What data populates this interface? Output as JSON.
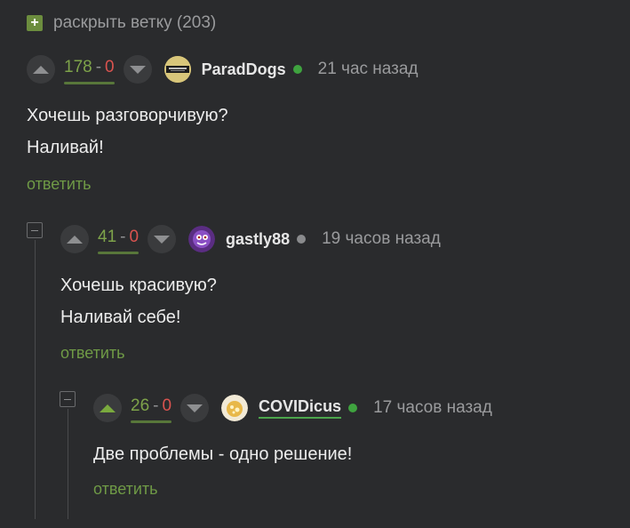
{
  "expand_thread": {
    "label": "раскрыть ветку (203)"
  },
  "comments": [
    {
      "rating_plus": "178",
      "rating_sep": "-",
      "rating_minus": "0",
      "nick": "ParadDogs",
      "online": true,
      "time": "21 час назад",
      "lines": [
        "Хочешь разговорчивую?",
        "Наливай!"
      ],
      "reply_label": "ответить"
    },
    {
      "rating_plus": "41",
      "rating_sep": "-",
      "rating_minus": "0",
      "nick": "gastly88",
      "online": false,
      "time": "19 часов назад",
      "lines": [
        "Хочешь красивую?",
        "Наливай себе!"
      ],
      "reply_label": "ответить"
    },
    {
      "rating_plus": "26",
      "rating_sep": "-",
      "rating_minus": "0",
      "nick": "COVIDicus",
      "online": true,
      "time": "17 часов назад",
      "lines": [
        "Две проблемы - одно решение!"
      ],
      "reply_label": "ответить"
    }
  ],
  "colors": {
    "background": "#2a2b2d",
    "accent_green": "#7ea34a",
    "minus_red": "#d9534f",
    "online_dot": "#3fa33f"
  },
  "icons": [
    "plus-square-icon",
    "arrow-up-icon",
    "arrow-down-icon",
    "minus-square-icon",
    "online-dot-icon"
  ]
}
